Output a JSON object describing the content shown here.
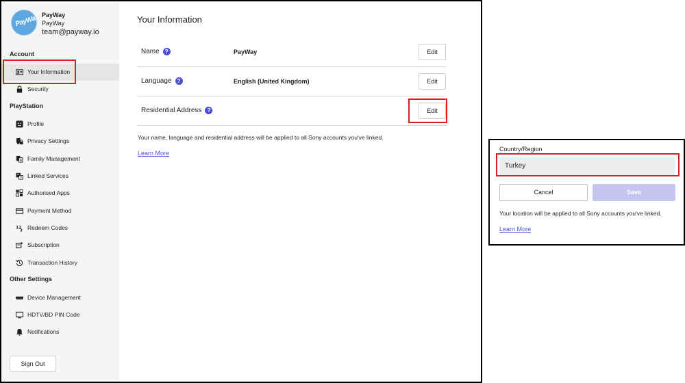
{
  "profile": {
    "avatar_text": "PayWay",
    "name": "PayWay",
    "subname": "PayWay",
    "email": "team@payway.io"
  },
  "sidebar": {
    "sections": {
      "account": "Account",
      "playstation": "PlayStation",
      "other": "Other Settings"
    },
    "items": [
      {
        "label": "Your Information",
        "icon": "id-card-icon"
      },
      {
        "label": "Security",
        "icon": "lock-icon"
      },
      {
        "label": "Profile",
        "icon": "smiley-icon"
      },
      {
        "label": "Privacy Settings",
        "icon": "privacy-shield-icon"
      },
      {
        "label": "Family Management",
        "icon": "family-icon"
      },
      {
        "label": "Linked Services",
        "icon": "linked-icon"
      },
      {
        "label": "Authorised Apps",
        "icon": "apps-icon"
      },
      {
        "label": "Payment Method",
        "icon": "card-icon"
      },
      {
        "label": "Redeem Codes",
        "icon": "code-icon"
      },
      {
        "label": "Subscription",
        "icon": "subscription-icon"
      },
      {
        "label": "Transaction History",
        "icon": "history-icon"
      },
      {
        "label": "Device Management",
        "icon": "device-icon"
      },
      {
        "label": "HDTV/BD PIN Code",
        "icon": "tv-icon"
      },
      {
        "label": "Notifications",
        "icon": "bell-icon"
      }
    ],
    "sign_out": "Sign Out"
  },
  "main": {
    "title": "Your Information",
    "rows": [
      {
        "label": "Name",
        "value": "PayWay",
        "edit": "Edit"
      },
      {
        "label": "Language",
        "value": "English (United Kingdom)",
        "edit": "Edit"
      },
      {
        "label": "Residential Address",
        "value": "",
        "edit": "Edit"
      }
    ],
    "help_glyph": "?",
    "info": "Your name, language and residential address will be applied to all Sony accounts you've linked.",
    "learn_more": "Learn More"
  },
  "address_panel": {
    "label": "Country/Region",
    "value": "Turkey",
    "cancel": "Cancel",
    "save": "Save",
    "info": "Your location will be applied to all Sony accounts you've linked.",
    "learn_more": "Learn More"
  },
  "colors": {
    "accent": "#4b4ed4",
    "highlight": "#e01b1b",
    "save_disabled": "#c6c5f2"
  }
}
